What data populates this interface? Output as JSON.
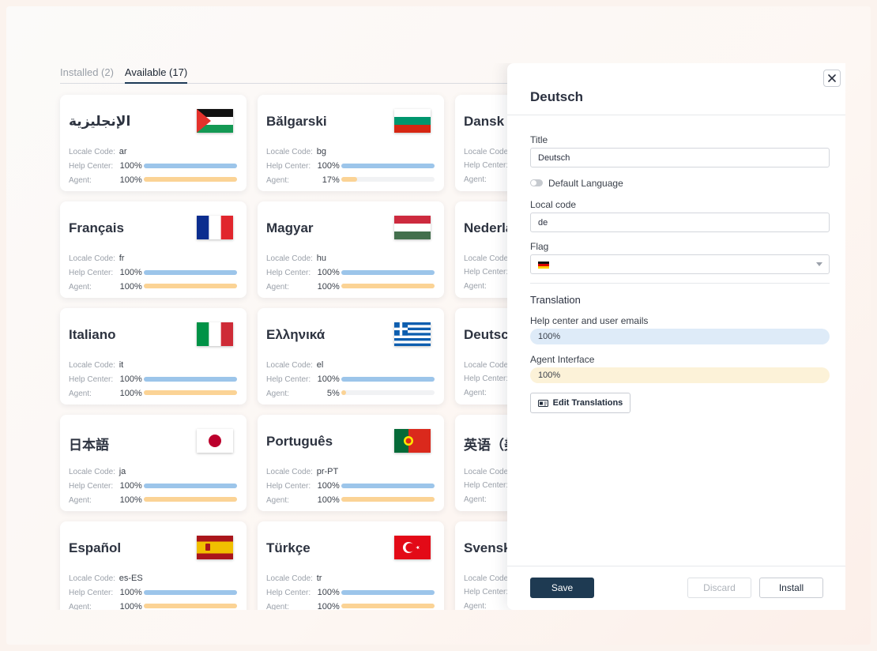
{
  "tabs": [
    {
      "label": "Installed (2)",
      "active": false
    },
    {
      "label": "Available (17)",
      "active": true
    }
  ],
  "row_labels": {
    "code": "Locale Code:",
    "help": "Help Center:",
    "agent": "Agent:"
  },
  "cards": [
    {
      "name": "الإنجليزية",
      "flag": "palestine",
      "code": "ar",
      "help": "100%",
      "help_pct": 100,
      "agent": "100%",
      "agent_pct": 100
    },
    {
      "name": "Bălgarski",
      "flag": "bulgaria",
      "code": "bg",
      "help": "100%",
      "help_pct": 100,
      "agent": "17%",
      "agent_pct": 17
    },
    {
      "name": "Dansk",
      "flag": "denmark",
      "code": "",
      "help": "",
      "help_pct": 0,
      "agent": "",
      "agent_pct": 0
    },
    {
      "name": "Français",
      "flag": "france",
      "code": "fr",
      "help": "100%",
      "help_pct": 100,
      "agent": "100%",
      "agent_pct": 100
    },
    {
      "name": "Magyar",
      "flag": "hungary",
      "code": "hu",
      "help": "100%",
      "help_pct": 100,
      "agent": "100%",
      "agent_pct": 100
    },
    {
      "name": "Nederla",
      "flag": "netherlands",
      "code": "",
      "help": "",
      "help_pct": 0,
      "agent": "",
      "agent_pct": 0
    },
    {
      "name": "Italiano",
      "flag": "italy",
      "code": "it",
      "help": "100%",
      "help_pct": 100,
      "agent": "100%",
      "agent_pct": 100
    },
    {
      "name": "Ελληνικά",
      "flag": "greece",
      "code": "el",
      "help": "100%",
      "help_pct": 100,
      "agent": "5%",
      "agent_pct": 5
    },
    {
      "name": "Deutsc",
      "flag": "germany",
      "code": "",
      "help": "",
      "help_pct": 0,
      "agent": "",
      "agent_pct": 0
    },
    {
      "name": "日本語",
      "flag": "japan",
      "code": "ja",
      "help": "100%",
      "help_pct": 100,
      "agent": "100%",
      "agent_pct": 100
    },
    {
      "name": "Português",
      "flag": "portugal",
      "code": "pr-PT",
      "help": "100%",
      "help_pct": 100,
      "agent": "100%",
      "agent_pct": 100
    },
    {
      "name": "英语（美",
      "flag": "usa",
      "code": "",
      "help": "",
      "help_pct": 0,
      "agent": "",
      "agent_pct": 0
    },
    {
      "name": "Español",
      "flag": "spain",
      "code": "es-ES",
      "help": "100%",
      "help_pct": 100,
      "agent": "100%",
      "agent_pct": 100
    },
    {
      "name": "Türkçe",
      "flag": "turkey",
      "code": "tr",
      "help": "100%",
      "help_pct": 100,
      "agent": "100%",
      "agent_pct": 100
    },
    {
      "name": "Svensk",
      "flag": "sweden",
      "code": "",
      "help": "",
      "help_pct": 0,
      "agent": "",
      "agent_pct": 0
    }
  ],
  "panel": {
    "title": "Deutsch",
    "title_label": "Title",
    "title_value": "Deutsch",
    "default_language_label": "Default Language",
    "default_language_on": false,
    "local_code_label": "Local code",
    "local_code_value": "de",
    "flag_label": "Flag",
    "flag_value": "germany",
    "translation_title": "Translation",
    "help_center_label": "Help center and user emails",
    "help_center_value": "100%",
    "agent_label": "Agent Interface",
    "agent_value": "100%",
    "edit_button": "Edit Translations",
    "save_button": "Save",
    "discard_button": "Discard",
    "install_button": "Install"
  },
  "colors": {
    "help_bar": "#9cc5ea",
    "agent_bar": "#fbd395",
    "primary_button": "#1e3a52"
  },
  "icons": {
    "close": "close-icon",
    "edit": "translate-icon",
    "chevron": "chevron-down-icon"
  }
}
